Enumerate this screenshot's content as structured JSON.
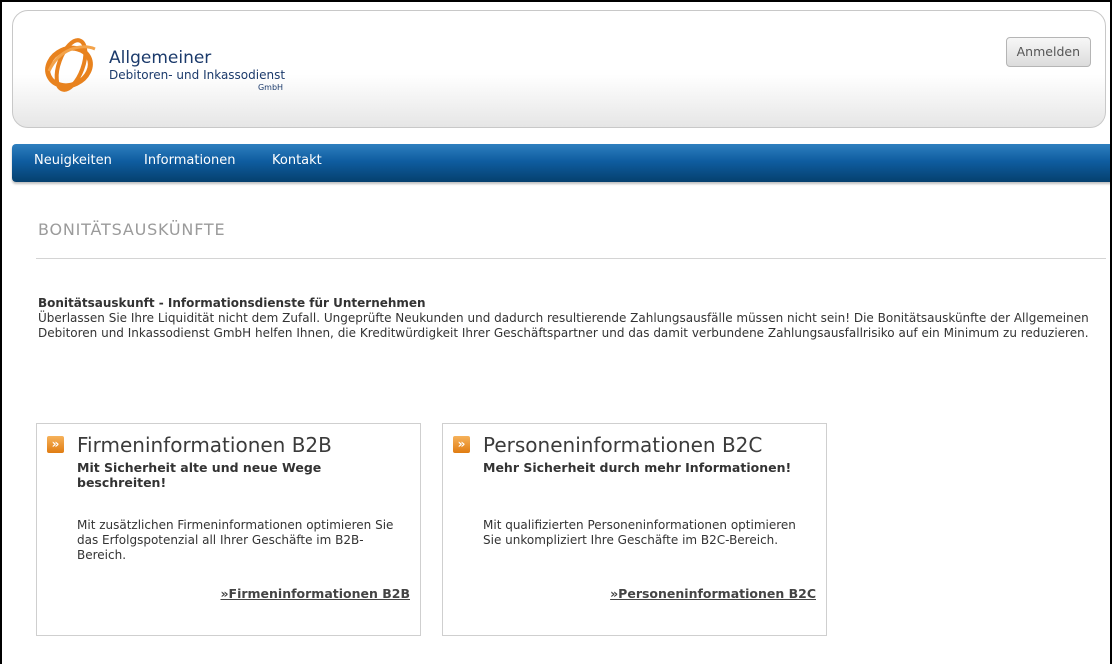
{
  "header": {
    "logo": {
      "line1": "Allgemeiner",
      "line2": "Debitoren- und Inkassodienst",
      "line3": "GmbH"
    },
    "login_label": "Anmelden"
  },
  "nav": {
    "items": [
      {
        "label": "Neuigkeiten"
      },
      {
        "label": "Informationen"
      },
      {
        "label": "Kontakt"
      }
    ]
  },
  "main": {
    "page_title": "BONITÄTSAUSKÜNFTE",
    "intro": {
      "heading": "Bonitätsauskunft - Informationsdienste für Unternehmen",
      "text": "Überlassen Sie Ihre Liquidität nicht dem Zufall. Ungeprüfte Neukunden und dadurch resultierende Zahlungsausfälle müssen nicht sein! Die Bonitätsauskünfte der Allgemeinen Debitoren und Inkassodienst GmbH helfen Ihnen, die Kreditwürdigkeit Ihrer Geschäftspartner und das damit verbundene Zahlungsausfallrisiko auf ein Minimum zu reduzieren."
    },
    "cards": [
      {
        "title": "Firmeninformationen B2B",
        "subtitle": "Mit Sicherheit alte und neue Wege beschreiten!",
        "body": "Mit zusätzlichen Firmeninformationen optimieren Sie das Erfolgspotenzial all Ihrer Geschäfte im B2B-Bereich.",
        "link": "»Firmeninformationen B2B"
      },
      {
        "title": "Personeninformationen B2C",
        "subtitle": "Mehr Sicherheit durch mehr Informationen!",
        "body": "Mit qualifizierten Personeninformationen optimieren Sie unkompliziert Ihre Geschäfte im B2C-Bereich.",
        "link": "»Personeninformationen B2C"
      }
    ],
    "card_icon_glyph": "»"
  },
  "colors": {
    "nav": "#0f5da0",
    "logo_text": "#1b3a6b",
    "logo_orange": "#e8821e",
    "icon_orange": "#e07c12"
  }
}
